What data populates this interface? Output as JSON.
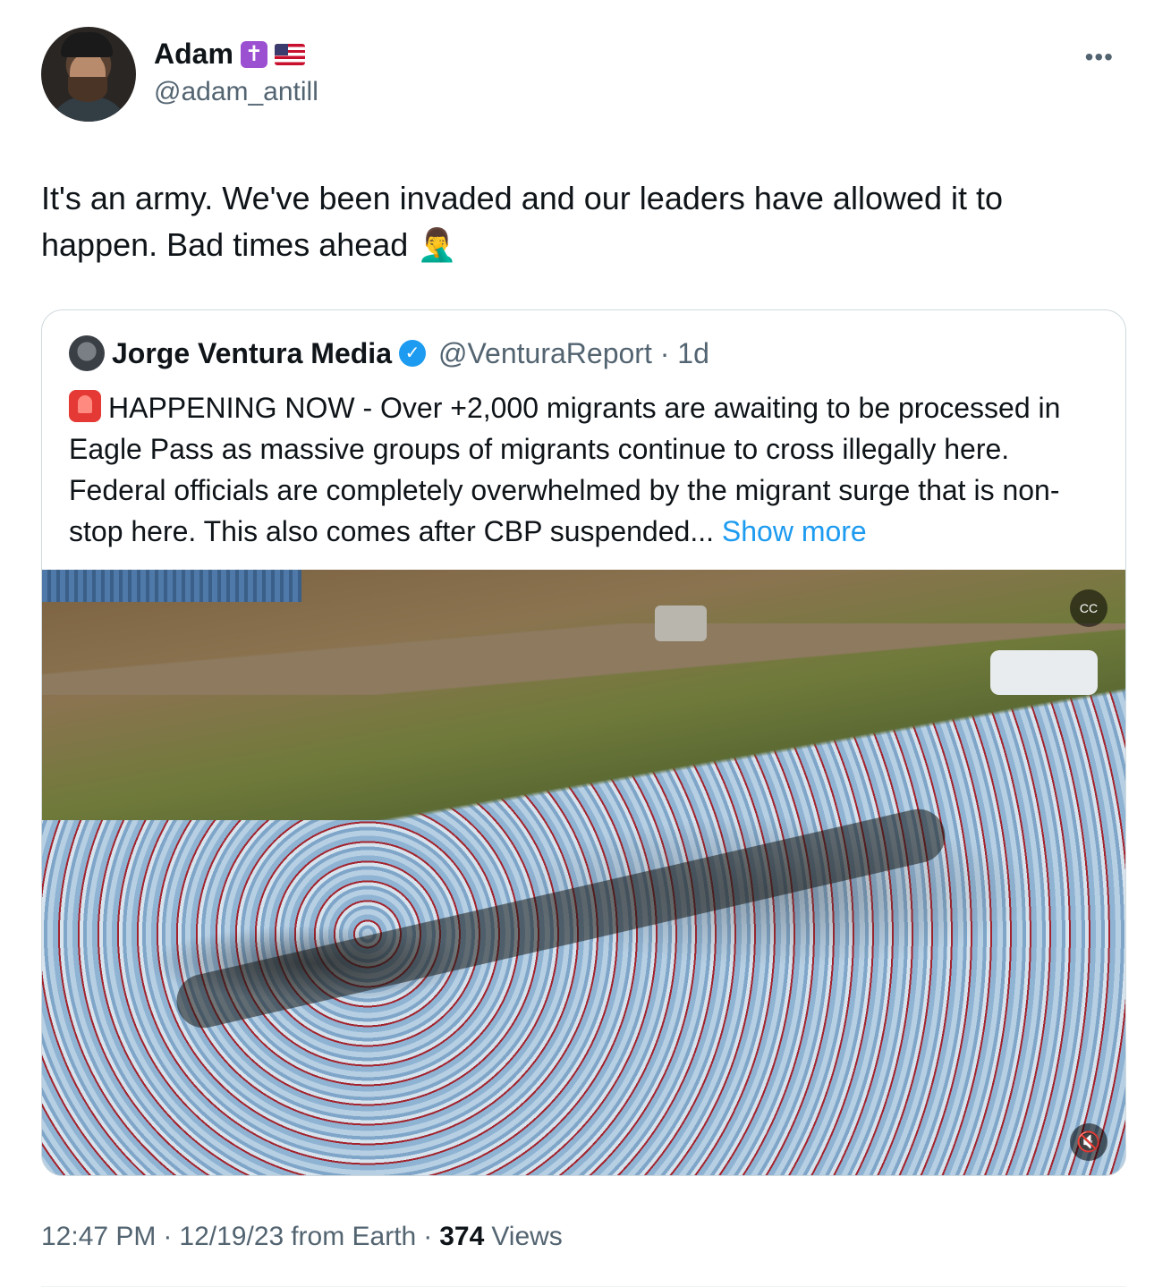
{
  "author": {
    "display_name": "Adam",
    "badges": [
      "cross-emoji",
      "us-flag-emoji"
    ],
    "handle": "@adam_antill"
  },
  "tweet": {
    "text": "It's an army. We've been invaded and our leaders have allowed it to happen. Bad times ahead",
    "emoji": "face-palm-emoji"
  },
  "quote": {
    "display_name": "Jorge Ventura Media",
    "verified": true,
    "handle": "@VenturaReport",
    "time": "1d",
    "text": "HAPPENING NOW - Over +2,000 migrants are awaiting to be processed in Eagle Pass as massive groups of migrants continue to cross illegally here. Federal officials are completely overwhelmed by the migrant surge that is non-stop here. This also comes after CBP suspended...",
    "show_more": "Show more",
    "media": {
      "type": "video",
      "controls": [
        "closed-captions-icon",
        "muted-volume-icon"
      ]
    }
  },
  "meta": {
    "time": "12:47 PM",
    "date": "12/19/23",
    "source": "from Earth",
    "views_count": "374",
    "views_label": "Views"
  },
  "colors": {
    "text": "#0f1419",
    "secondary": "#536471",
    "link": "#1d9bf0",
    "border": "#cfd9de"
  }
}
